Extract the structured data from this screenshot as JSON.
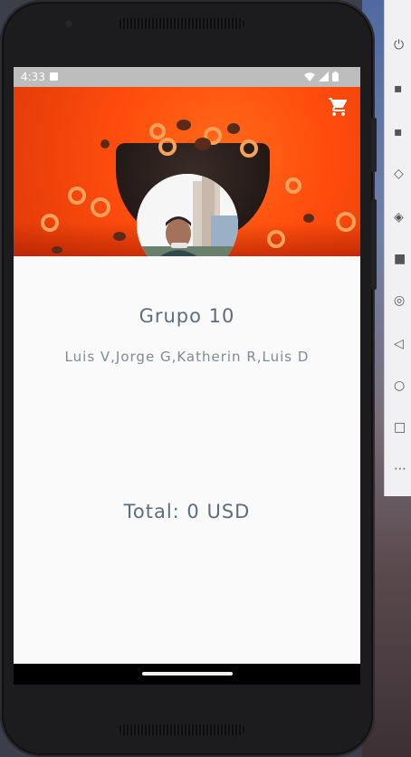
{
  "status_bar": {
    "time": "4:33"
  },
  "header": {
    "cart_icon": "shopping-cart-icon",
    "accent_color": "#ff5a14"
  },
  "profile": {
    "group_name": "Grupo 10",
    "members": "Luis V,Jorge G,Katherin R,Luis D"
  },
  "cart": {
    "total_label": "Total: 0 USD"
  },
  "colors": {
    "text_primary": "#5b6e80",
    "text_secondary": "#7d8a96",
    "screen_bg": "#fafafa",
    "status_bar_bg": "#bdbdbd"
  }
}
